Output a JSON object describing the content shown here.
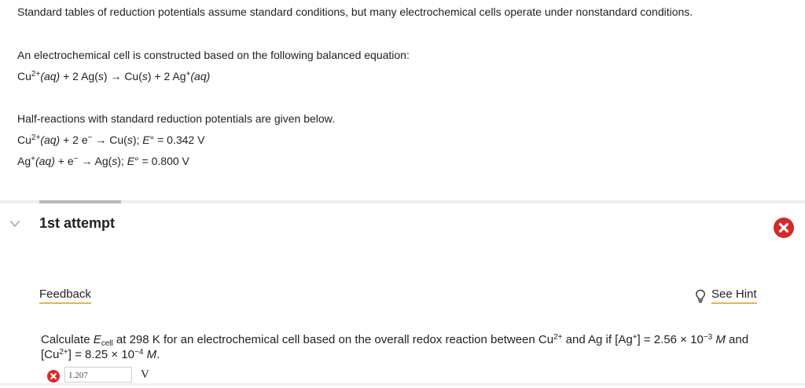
{
  "intro": {
    "text": "Standard tables of reduction potentials assume standard conditions, but many electrochemical cells operate under nonstandard conditions."
  },
  "cell": {
    "lead": "An electrochemical cell is constructed based on the following balanced equation:",
    "eq": {
      "p1": "Cu",
      "p1sup": "2+",
      "p2": "(aq)",
      "p3": " + 2 Ag(",
      "p4": "s",
      "p5": ") → Cu(",
      "p6": "s",
      "p7": ") + 2 Ag",
      "p7sup": "+",
      "p8": "(aq)"
    }
  },
  "half": {
    "lead": "Half-reactions with standard reduction potentials are given below.",
    "r1": {
      "a": "Cu",
      "asup": "2+",
      "b": "(aq)",
      "c": " + 2 e",
      "csup": "−",
      "d": " → Cu(",
      "e": "s",
      "f": "); ",
      "g": "E",
      "h": "° = 0.342 V"
    },
    "r2": {
      "a": "Ag",
      "asup": "+",
      "b": "(aq)",
      "c": " + e",
      "csup": "−",
      "d": " → Ag(",
      "e": "s",
      "f": "); ",
      "g": "E",
      "h": "° = 0.800 V"
    }
  },
  "attempt": {
    "title": "1st attempt"
  },
  "links": {
    "feedback": "Feedback",
    "hint": "See Hint"
  },
  "question": {
    "a": "Calculate ",
    "b": "E",
    "bsub": "cell",
    "c": " at 298 K for an electrochemical cell based on the overall redox reaction between Cu",
    "csup": "2+",
    "d": " and Ag if [Ag",
    "dsup": "+",
    "e": "] = 2.56 × 10",
    "esup": "−3",
    "f": " ",
    "g": "M",
    "h": " and [Cu",
    "hsup": "2+",
    "i": "] = 8.25 × 10",
    "isup": "−4",
    "j": " ",
    "k": "M",
    "l": "."
  },
  "answer": {
    "value": "1.207",
    "unit": "V"
  },
  "colors": {
    "error_red": "#d62828",
    "link_underline": "#e2b84a",
    "divider": "#eeeeee"
  },
  "icons": {
    "expand": "chevron-down-icon",
    "status": "incorrect-x-icon",
    "hint": "lightbulb-icon"
  }
}
